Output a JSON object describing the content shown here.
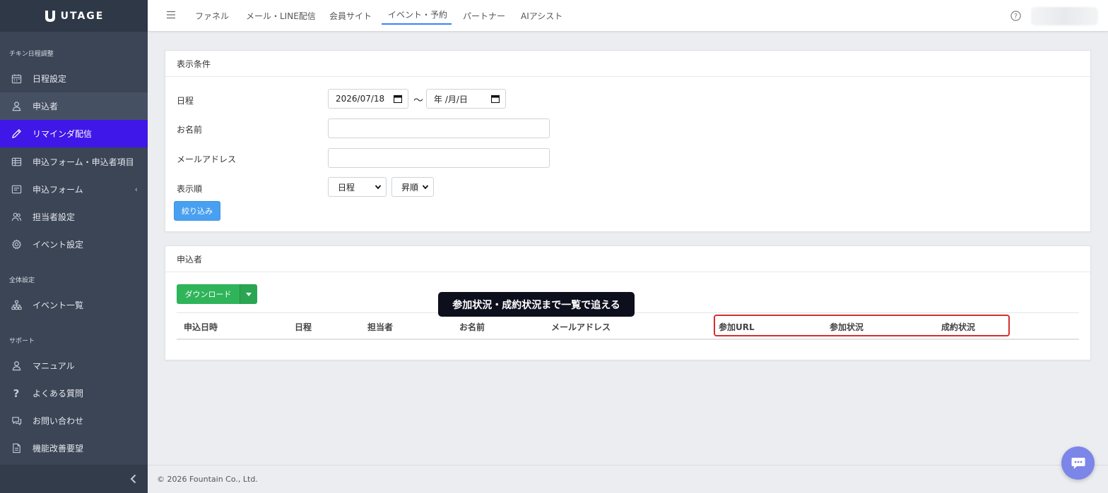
{
  "brand": {
    "name": "UTAGE"
  },
  "sidebar": {
    "section_event": "チキン日程調整",
    "items": [
      {
        "label": "日程設定",
        "icon": "calendar-icon"
      },
      {
        "label": "申込者",
        "icon": "user-icon"
      },
      {
        "label": "リマインダ配信",
        "icon": "pencil-icon"
      },
      {
        "label": "申込フォーム・申込者項目",
        "icon": "table-icon"
      },
      {
        "label": "申込フォーム",
        "icon": "form-icon",
        "chevron": "‹"
      },
      {
        "label": "担当者設定",
        "icon": "users-icon"
      },
      {
        "label": "イベント設定",
        "icon": "gear-icon"
      }
    ],
    "section_global": "全体設定",
    "global_items": [
      {
        "label": "イベント一覧",
        "icon": "sitemap-icon"
      }
    ],
    "section_support": "サポート",
    "support_items": [
      {
        "label": "マニュアル",
        "icon": "person-icon"
      },
      {
        "label": "よくある質問",
        "icon": "question-icon"
      },
      {
        "label": "お問い合わせ",
        "icon": "chat-icon"
      },
      {
        "label": "機能改善要望",
        "icon": "document-icon"
      }
    ]
  },
  "topnav": {
    "items": [
      {
        "label": "ファネル"
      },
      {
        "label": "メール・LINE配信"
      },
      {
        "label": "会員サイト"
      },
      {
        "label": "イベント・予約",
        "active": true
      },
      {
        "label": "パートナー"
      },
      {
        "label": "AIアシスト"
      }
    ]
  },
  "filter": {
    "title": "表示条件",
    "date_label": "日程",
    "date_from": "2026/07/18",
    "range_sep": "〜",
    "date_to_placeholder": "年 /月/日",
    "name_label": "お名前",
    "name_value": "",
    "email_label": "メールアドレス",
    "email_value": "",
    "order_label": "表示順",
    "order_by": "日程",
    "order_dir": "昇順",
    "submit": "絞り込み"
  },
  "applicants": {
    "title": "申込者",
    "download": "ダウンロード",
    "columns": [
      "申込日時",
      "日程",
      "担当者",
      "お名前",
      "メールアドレス",
      "参加URL",
      "参加状況",
      "成約状況"
    ],
    "rows": []
  },
  "callout": "参加状況・成約状況まで一覧で追える",
  "footer": {
    "copyright": "© 2026 Fountain Co., Ltd."
  },
  "colors": {
    "sidebar_bg": "#3b4556",
    "active_item": "#3f17e8",
    "primary_button": "#4aa0f0",
    "download_button": "#2fb45a",
    "highlight_border": "#d32f2f"
  }
}
